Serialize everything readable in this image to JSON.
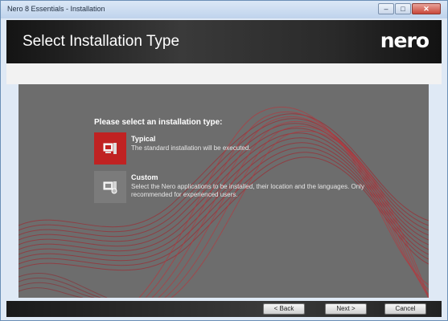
{
  "window": {
    "title": "Nero 8 Essentials - Installation",
    "minimize_glyph": "–",
    "maximize_glyph": "□",
    "close_glyph": "✕"
  },
  "header": {
    "title": "Select Installation Type",
    "logo": "nero"
  },
  "content": {
    "prompt": "Please select an installation type:",
    "options": [
      {
        "name": "Typical",
        "description": "The standard installation will be executed.",
        "icon": "computer-install-icon",
        "selected": true
      },
      {
        "name": "Custom",
        "description": "Select the Nero applications to be installed, their location and the languages. Only recommended for experienced users.",
        "icon": "custom-install-icon",
        "selected": false
      }
    ]
  },
  "footer": {
    "back_label": "< Back",
    "next_label": "Next >",
    "cancel_label": "Cancel"
  },
  "colors": {
    "accent": "#c02222",
    "panel": "#6d6d6d",
    "header": "#2a2a2a"
  }
}
